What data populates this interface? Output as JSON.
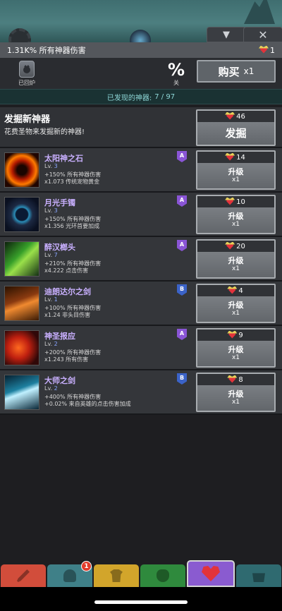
{
  "header": {
    "dps_text": "1.31K% 所有神器伤害",
    "relic_count": "1"
  },
  "toolbar": {
    "salvage_label": "已回炉",
    "percent_symbol": "%",
    "percent_label": "关",
    "buy_label": "购买",
    "buy_multiplier": "x1"
  },
  "discovered": {
    "label": "已发现的神器:",
    "value": "7 / 97"
  },
  "discover": {
    "title": "发掘新神器",
    "desc": "花费圣物来发掘新的神器!",
    "cost": "46",
    "button_label": "发掘"
  },
  "artifacts": [
    {
      "name": "太阳神之石",
      "lv_prefix": "Lv.",
      "level": "3",
      "effect1": "+150% 所有神器伤害",
      "effect2": "x1.073 传统宠物黄金",
      "grade": "A",
      "cost": "14",
      "action": "升级",
      "mult": "x1",
      "icon": "sun-stone-icon"
    },
    {
      "name": "月光手镯",
      "lv_prefix": "Lv.",
      "level": "3",
      "effect1": "+150% 所有神器伤害",
      "effect2": "x1.356 光环首要加成",
      "grade": "A",
      "cost": "10",
      "action": "升级",
      "mult": "x1",
      "icon": "moonlight-bracelet-icon"
    },
    {
      "name": "醉汉榔头",
      "lv_prefix": "Lv.",
      "level": "7",
      "effect1": "+210% 所有神器伤害",
      "effect2": "x4.222 点击伤害",
      "grade": "A",
      "cost": "20",
      "action": "升级",
      "mult": "x1",
      "icon": "drunken-hammer-icon"
    },
    {
      "name": "迪朗达尔之剑",
      "lv_prefix": "Lv.",
      "level": "1",
      "effect1": "+100% 所有神器伤害",
      "effect2": "x1.24 非头目伤害",
      "grade": "B",
      "cost": "4",
      "action": "升级",
      "mult": "x1",
      "icon": "durendal-sword-icon"
    },
    {
      "name": "神圣报应",
      "lv_prefix": "Lv.",
      "level": "2",
      "effect1": "+200% 所有神器伤害",
      "effect2": "x1.243 所有伤害",
      "grade": "A",
      "cost": "9",
      "action": "升级",
      "mult": "x1",
      "icon": "divine-retribution-icon"
    },
    {
      "name": "大师之剑",
      "lv_prefix": "Lv.",
      "level": "2",
      "effect1": "+400% 所有神器伤害",
      "effect2": "+0.02% 来自英雄的点击伤害加成",
      "grade": "B",
      "cost": "8",
      "action": "升级",
      "mult": "x1",
      "icon": "master-sword-icon"
    }
  ],
  "nav": {
    "badge_count": "1"
  },
  "colors": {
    "grade_A": "#8a55d6",
    "grade_B": "#3b63c8",
    "artifact_name": "#c9b0ff",
    "discovered_text": "#8fd8d8"
  }
}
